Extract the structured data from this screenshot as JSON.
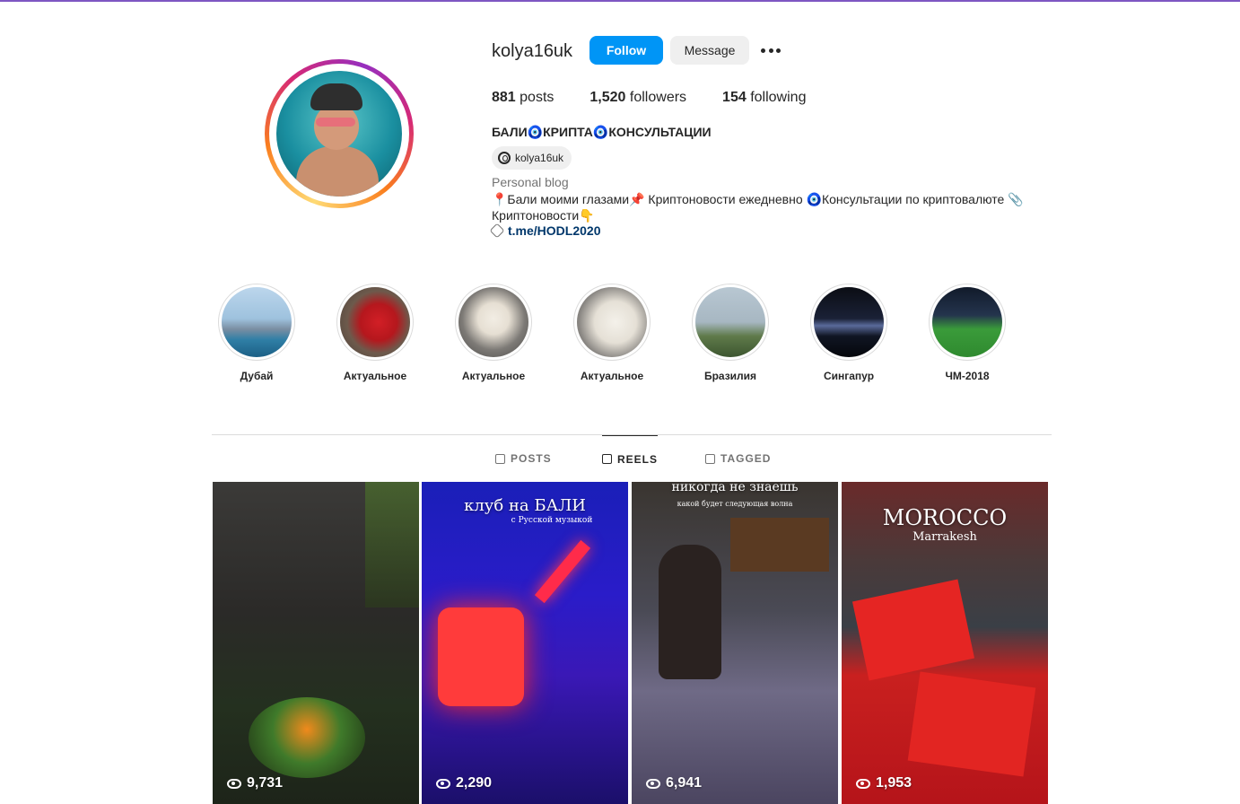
{
  "profile": {
    "username": "kolya16uk",
    "follow_label": "Follow",
    "message_label": "Message",
    "posts_count": "881",
    "posts_label": "posts",
    "followers_count": "1,520",
    "followers_label": "followers",
    "following_count": "154",
    "following_label": "following",
    "full_name": "БАЛИ🧿КРИПТА🧿КОНСУЛЬТАЦИИ",
    "threads_handle": "kolya16uk",
    "category": "Personal blog",
    "bio": "📍Бали моими глазами📌 Криптоновости ежедневно 🧿Консультации по криптовалюте 📎 Криптоновости👇",
    "link": "t.me/HODL2020"
  },
  "highlights": [
    {
      "label": "Дубай"
    },
    {
      "label": "Актуальное"
    },
    {
      "label": "Актуальное"
    },
    {
      "label": "Актуальное"
    },
    {
      "label": "Бразилия"
    },
    {
      "label": "Сингапур"
    },
    {
      "label": "ЧМ-2018"
    }
  ],
  "tabs": {
    "posts": "POSTS",
    "reels": "REELS",
    "tagged": "TAGGED"
  },
  "reels": [
    {
      "views": "9,731"
    },
    {
      "views": "2,290",
      "caption": "клуб на БАЛИ",
      "subcaption": "с Русской музыкой"
    },
    {
      "views": "6,941",
      "caption": "никогда не знаешь",
      "subcaption": "какой будет следующая волна"
    },
    {
      "views": "1,953",
      "caption": "MOROCCO",
      "subcaption": "Marrakesh"
    }
  ],
  "colors": {
    "follow": "#0095f6",
    "link": "#00376b",
    "muted": "#737373"
  }
}
